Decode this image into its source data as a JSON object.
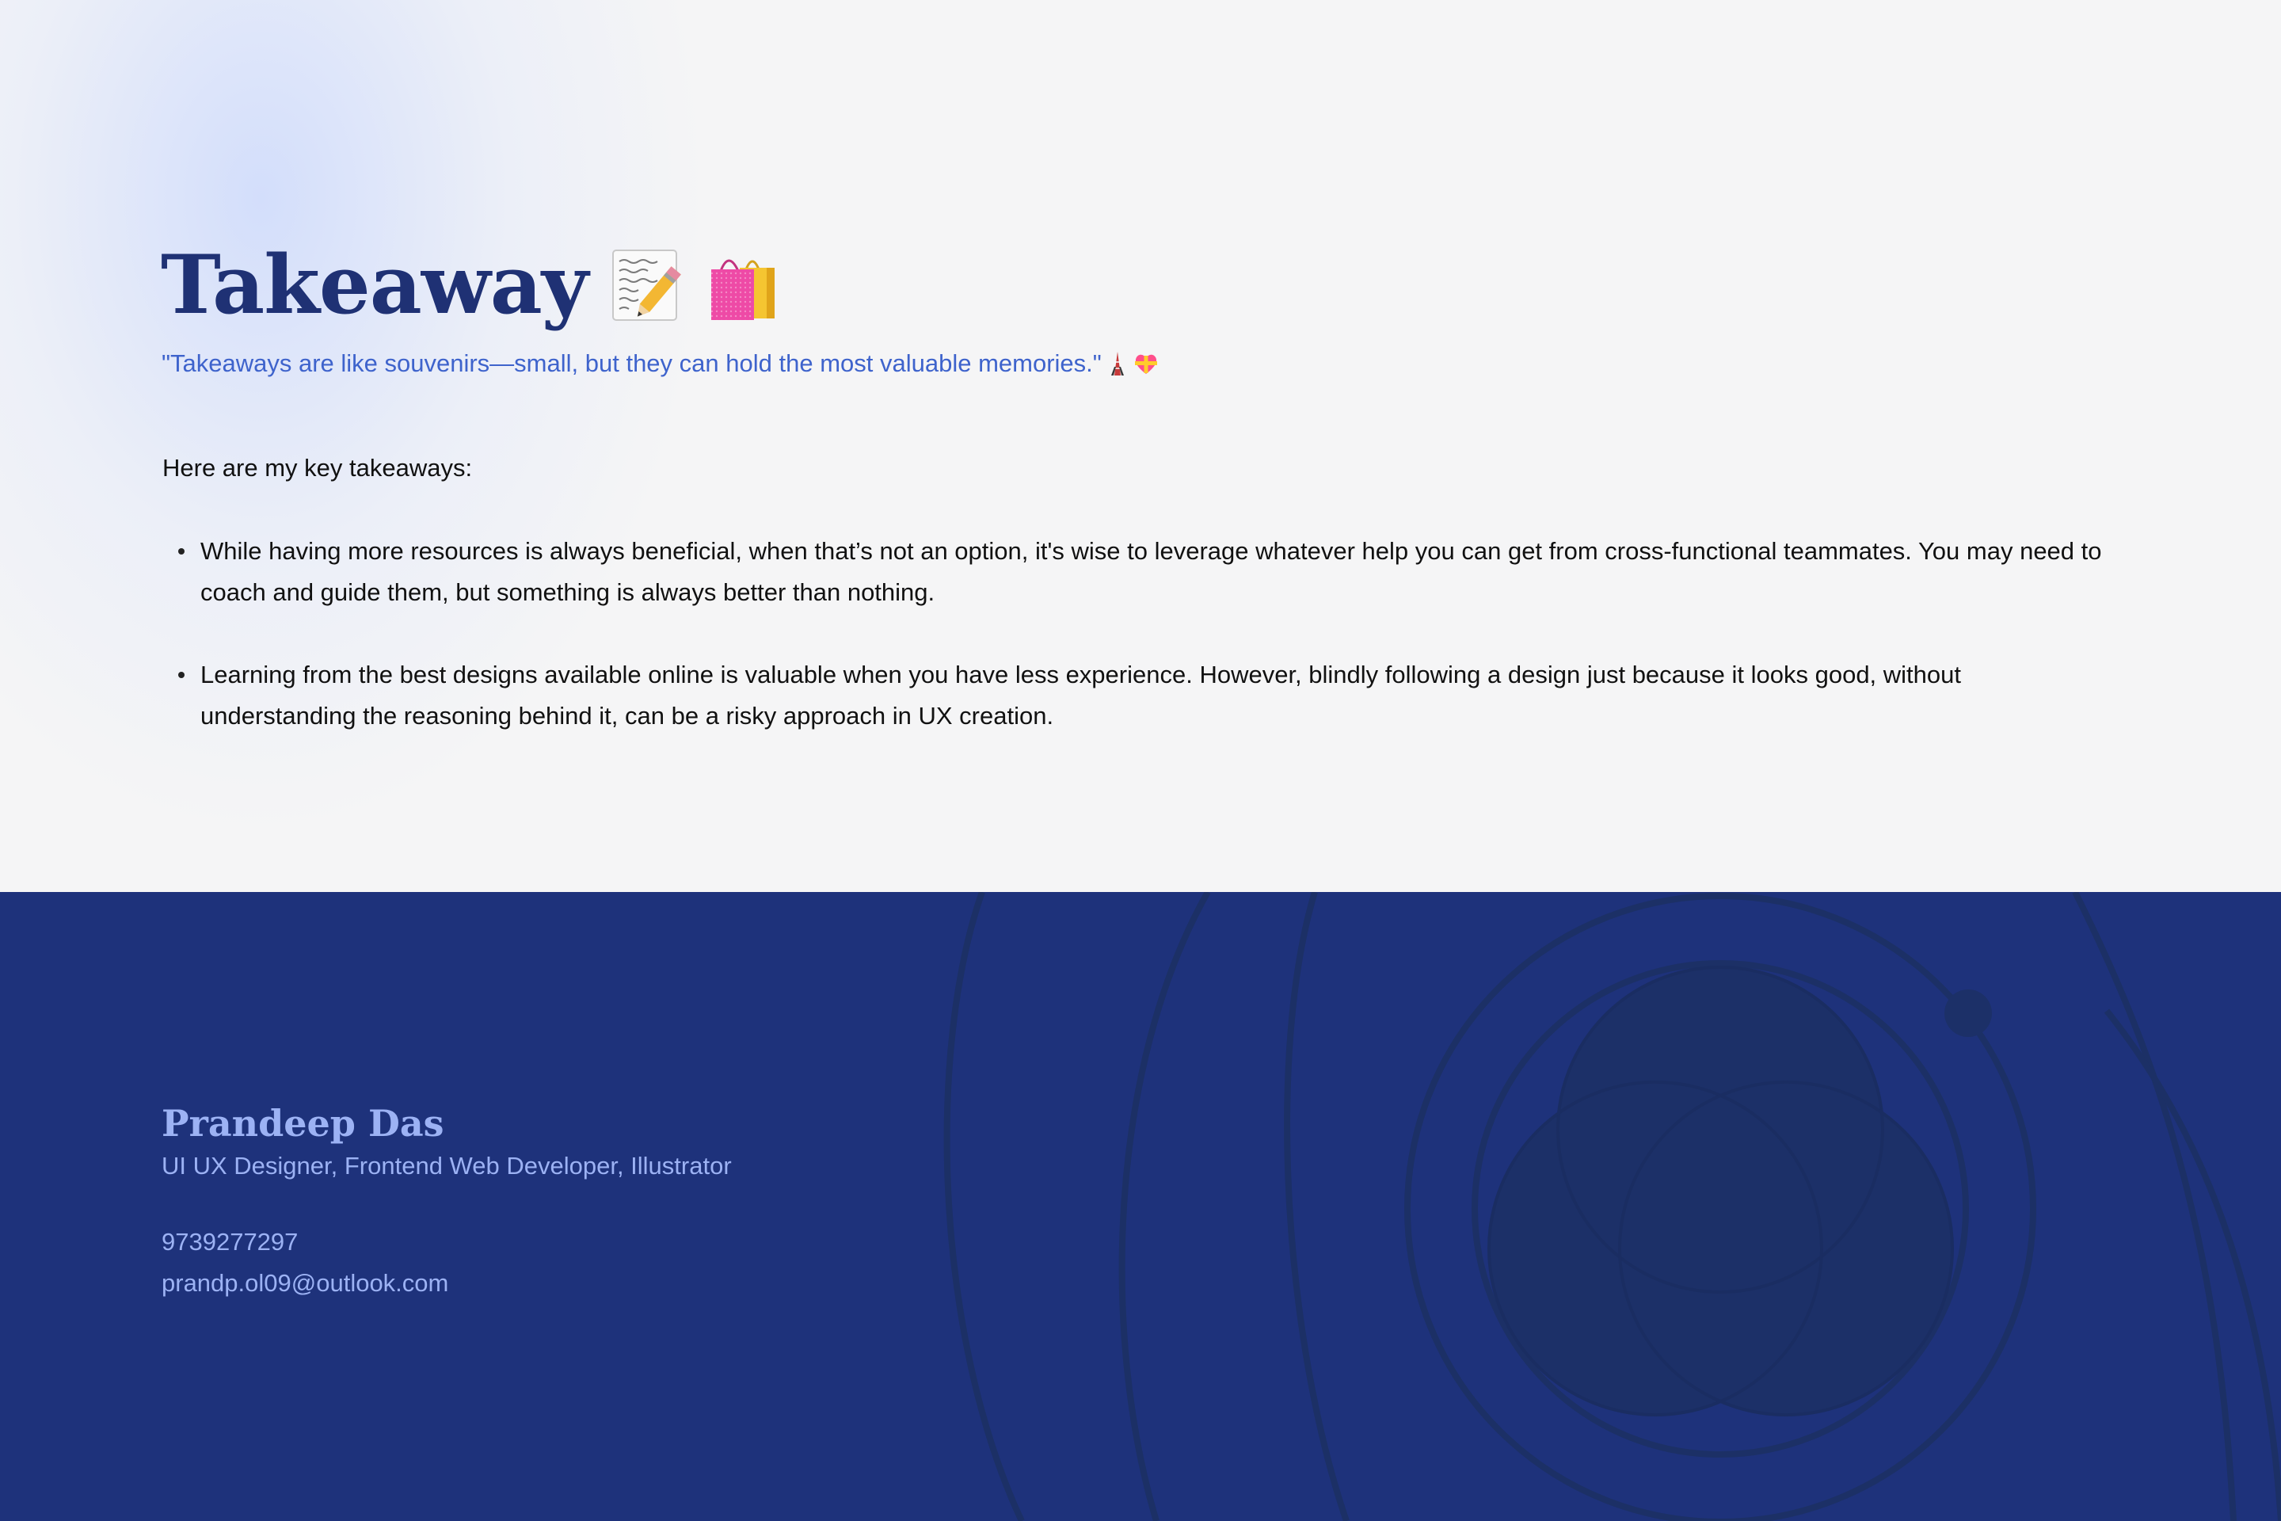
{
  "section": {
    "title": "Takeaway",
    "title_icons": [
      "memo-icon",
      "shopping-bags-icon"
    ],
    "quote": "\"Takeaways are like souvenirs—small, but they can hold the most valuable memories.\"",
    "quote_icons": [
      "tokyo-tower-icon",
      "heart-with-ribbon-icon"
    ],
    "intro": "Here are my key takeaways:",
    "bullets": [
      "While having more resources is always beneficial, when that’s not an option, it's wise to leverage whatever help you can get from cross-functional teammates. You may need to coach and guide them, but something is always better than nothing.",
      "Learning from the best designs available online is valuable when you have less experience. However, blindly following a design just because it looks good, without understanding the reasoning behind it, can be a risky approach in UX creation."
    ]
  },
  "footer": {
    "name": "Prandeep Das",
    "role": "UI UX Designer, Frontend Web Developer, Illustrator",
    "phone": "9739277297",
    "email": "prandp.ol09@outlook.com"
  },
  "colors": {
    "title": "#1f3174",
    "quote": "#3e63cc",
    "footer_bg": "#1e327b",
    "footer_text": "#9cb2f4",
    "page_bg": "#f5f5f6"
  }
}
